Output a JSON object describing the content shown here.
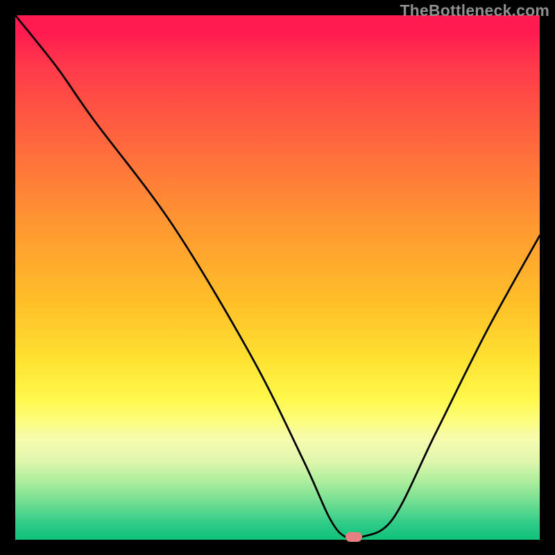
{
  "watermark": "TheBottleneck.com",
  "chart_data": {
    "type": "line",
    "title": "",
    "xlabel": "",
    "ylabel": "",
    "xlim": [
      0,
      100
    ],
    "ylim": [
      0,
      100
    ],
    "grid": false,
    "series": [
      {
        "name": "bottleneck-curve",
        "x": [
          0,
          8,
          15,
          30,
          45,
          55,
          60,
          63,
          66,
          72,
          80,
          90,
          100
        ],
        "values": [
          100,
          90,
          80,
          60,
          35,
          15,
          4,
          0.5,
          0.5,
          4,
          20,
          40,
          58
        ]
      }
    ],
    "marker": {
      "x": 64.5,
      "y": 0.5,
      "color": "#e48080"
    },
    "background_gradient": {
      "top": "#ff1a50",
      "bottom": "#0fc27a",
      "axis_border": "#000000"
    }
  }
}
